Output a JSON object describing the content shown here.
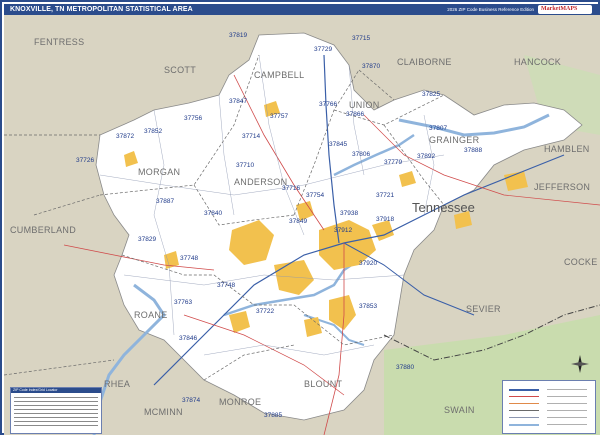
{
  "header": {
    "title": "KNOXVILLE, TN METROPOLITAN STATISTICAL AREA",
    "edition": "2026 ZIP Code Business Reference Edition",
    "brand": "MarketMAPS"
  },
  "map": {
    "state_label": "Tennessee",
    "counties": [
      {
        "id": "fentress",
        "name": "FENTRESS"
      },
      {
        "id": "scott",
        "name": "SCOTT"
      },
      {
        "id": "campbell",
        "name": "CAMPBELL"
      },
      {
        "id": "claiborne",
        "name": "CLAIBORNE"
      },
      {
        "id": "hancock",
        "name": "HANCOCK"
      },
      {
        "id": "union",
        "name": "UNION"
      },
      {
        "id": "grainger",
        "name": "GRAINGER"
      },
      {
        "id": "hamblen",
        "name": "HAMBLEN"
      },
      {
        "id": "morgan",
        "name": "MORGAN"
      },
      {
        "id": "anderson",
        "name": "ANDERSON"
      },
      {
        "id": "jefferson",
        "name": "JEFFERSON"
      },
      {
        "id": "cumberland",
        "name": "CUMBERLAND"
      },
      {
        "id": "cocke",
        "name": "COCKE"
      },
      {
        "id": "roane",
        "name": "ROANE"
      },
      {
        "id": "sevier",
        "name": "SEVIER"
      },
      {
        "id": "blount",
        "name": "BLOUNT"
      },
      {
        "id": "rhea",
        "name": "RHEA"
      },
      {
        "id": "monroe",
        "name": "MONROE"
      },
      {
        "id": "mcminn",
        "name": "MCMINN"
      },
      {
        "id": "swain",
        "name": "SWAIN"
      }
    ],
    "zip_codes": [
      "37819",
      "37729",
      "37715",
      "37870",
      "37847",
      "37766",
      "37825",
      "37872",
      "37852",
      "37756",
      "37757",
      "37866",
      "37779",
      "37806",
      "37892",
      "37714",
      "37845",
      "37807",
      "37888",
      "37726",
      "37710",
      "37716",
      "37754",
      "37721",
      "37887",
      "37840",
      "37849",
      "37938",
      "37912",
      "37918",
      "37829",
      "37748",
      "37920",
      "37763",
      "37722",
      "37853",
      "37880",
      "37874",
      "37885",
      "37846",
      "37748"
    ],
    "legend_title": "ZIP Code Index/Grid Locator",
    "legend_items": [
      "Interstate",
      "U.S. Highway",
      "State Highway",
      "County Boundary",
      "ZIP Code Boundary",
      "Water"
    ]
  },
  "colors": {
    "frame": "#2b4c8c",
    "msa_fill": "#ffffff",
    "outside_fill": "#d9d4c2",
    "forest": "#c9dcae",
    "water": "#8fb4dc",
    "urban": "#f2c14e",
    "zip_text": "#1f3a8a"
  }
}
